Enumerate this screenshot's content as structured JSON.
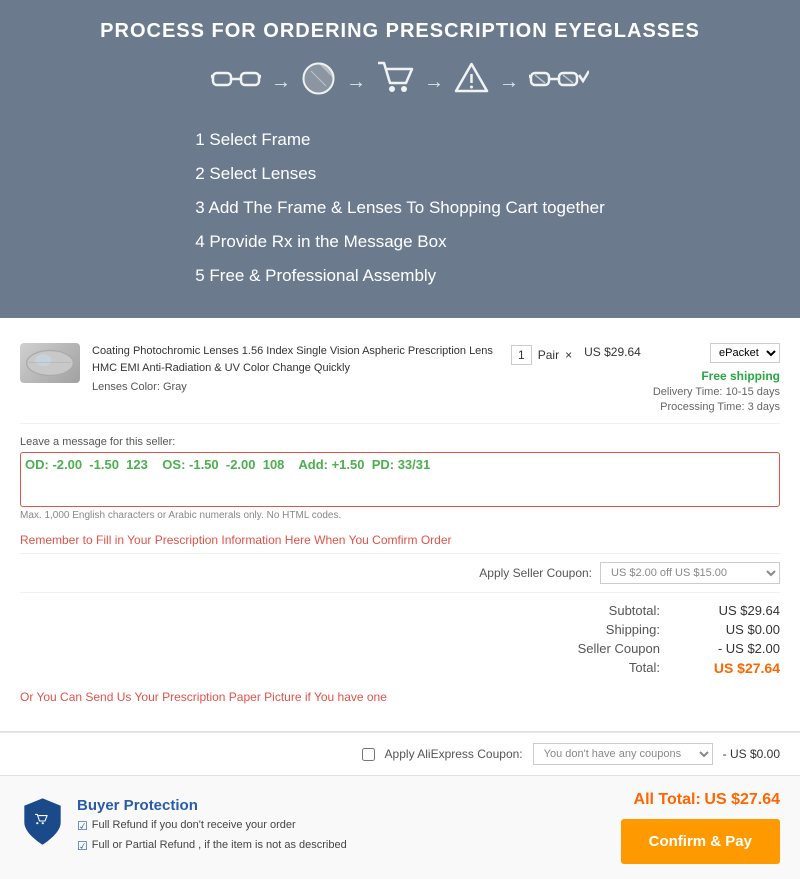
{
  "header": {
    "title": "PROCESS FOR ORDERING PRESCRIPTION EYEGLASSES",
    "steps": [
      "1 Select Frame",
      "2 Select Lenses",
      "3 Add The Frame & Lenses To Shopping Cart together",
      "4 Provide Rx in the Message Box",
      "5 Free & Professional Assembly"
    ]
  },
  "product": {
    "name": "Coating Photochromic Lenses 1.56 Index Single Vision Aspheric Prescription Lens HMC EMI Anti-Radiation & UV Color Change Quickly",
    "lenses_color_label": "Lenses Color:",
    "lenses_color_value": "Gray",
    "quantity": "1",
    "unit": "Pair",
    "price": "US $29.64",
    "shipping_option": "ePacket",
    "free_shipping": "Free shipping",
    "delivery_label": "Delivery Time:",
    "delivery_value": "10-15 days",
    "processing_label": "Processing Time:",
    "processing_value": "3 days"
  },
  "message_box": {
    "label": "Leave a message for this seller:",
    "placeholder": "OD: -2.00  -1.50  123    OS: -1.50  -2.00  108    Add: +1.50  PD: 33/31",
    "hint": "Max. 1,000 English characters or Arabic numerals only. No HTML codes.",
    "rx_value": "OD: -2.00  -1.50  123    OS: -1.50  -2.00  108    Add: +1.50  PD: 33/31"
  },
  "warnings": {
    "reminder": "Remember to Fill in Your Prescription Information Here When You Comfirm Order",
    "alternative": "Or You Can Send Us Your Prescription Paper Picture if You have one"
  },
  "coupon": {
    "label": "Apply Seller Coupon:",
    "value": "US $2.00 off US $15.00",
    "placeholder": "US $2.00 off US $15.00"
  },
  "totals": {
    "subtotal_label": "Subtotal:",
    "subtotal_value": "US $29.64",
    "shipping_label": "Shipping:",
    "shipping_value": "US $0.00",
    "seller_coupon_label": "Seller Coupon",
    "seller_coupon_value": "- US $2.00",
    "total_label": "Total:",
    "total_value": "US $27.64"
  },
  "ali_coupon": {
    "label": "Apply AliExpress Coupon:",
    "placeholder": "You don't have any coupons",
    "discount": "- US $0.00"
  },
  "footer": {
    "protection_title": "Buyer Protection",
    "protection_items": [
      "Full Refund if you don't receive your order",
      "Full or Partial Refund , if the item is not as described"
    ],
    "all_total_label": "All Total:",
    "all_total_value": "US $27.64",
    "confirm_btn": "Confirm & Pay"
  }
}
